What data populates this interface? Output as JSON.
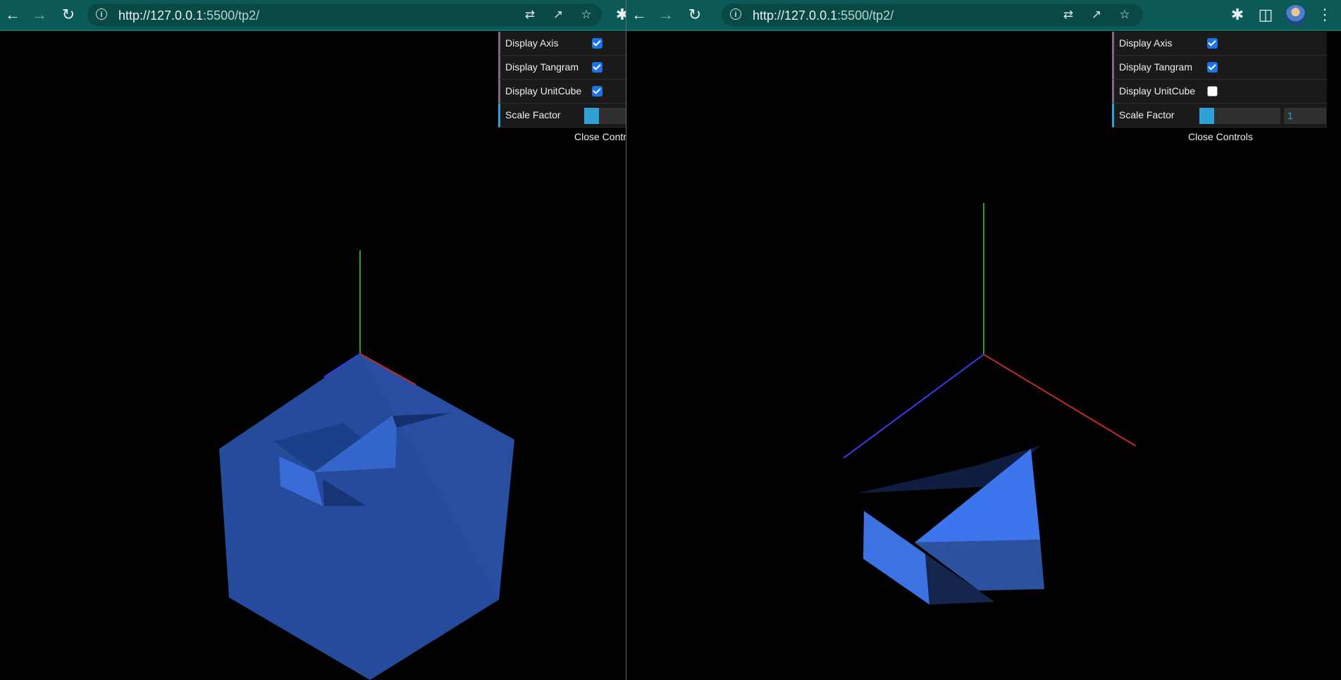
{
  "left_window": {
    "url_host": "http://127.0.0.1",
    "url_rest": ":5500/tp2/",
    "controls": {
      "display_axis_label": "Display Axis",
      "display_axis_checked": true,
      "display_tangram_label": "Display Tangram",
      "display_tangram_checked": true,
      "display_unitcube_label": "Display UnitCube",
      "display_unitcube_checked": true,
      "scale_factor_label": "Scale Factor",
      "close_label": "Close Controls"
    }
  },
  "right_window": {
    "url_host": "http://127.0.0.1",
    "url_rest": ":5500/tp2/",
    "controls": {
      "display_axis_label": "Display Axis",
      "display_axis_checked": true,
      "display_tangram_label": "Display Tangram",
      "display_tangram_checked": true,
      "display_unitcube_label": "Display UnitCube",
      "display_unitcube_checked": false,
      "scale_factor_label": "Scale Factor",
      "scale_factor_value": "1",
      "close_label": "Close Controls"
    }
  },
  "toolbar_icons": [
    "back-icon",
    "forward-icon",
    "reload-icon",
    "info-icon",
    "translate-icon",
    "share-icon",
    "star-icon",
    "extensions-icon",
    "side-panel-icon",
    "avatar",
    "menu-icon"
  ],
  "colors": {
    "toolbar": "#0b5a57",
    "omnibox": "#084946",
    "gui_bg": "#1a1a1a",
    "slider": "#2fa1d6",
    "checkbox": "#1a73e8",
    "cube": "#2a55b5",
    "tangram_light": "#3f78f0",
    "axis_x": "#c42a2a",
    "axis_y": "#2e9a2e",
    "axis_z": "#3a3af0"
  }
}
